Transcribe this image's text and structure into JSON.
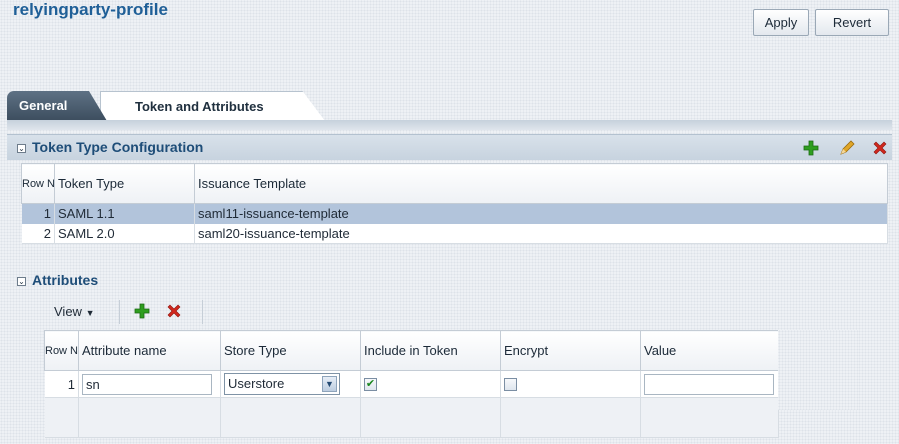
{
  "header": {
    "title": "relyingparty-profile",
    "apply_label": "Apply",
    "revert_label": "Revert"
  },
  "tabs": [
    {
      "label": "General",
      "active": false
    },
    {
      "label": "Token and Attributes",
      "active": true
    }
  ],
  "token_section": {
    "title": "Token Type Configuration",
    "columns": [
      "Row No.",
      "Token Type",
      "Issuance Template"
    ],
    "rows": [
      {
        "no": "1",
        "token_type": "SAML 1.1",
        "template": "saml11-issuance-template",
        "selected": true
      },
      {
        "no": "2",
        "token_type": "SAML 2.0",
        "template": "saml20-issuance-template",
        "selected": false
      }
    ]
  },
  "attributes_section": {
    "title": "Attributes",
    "view_label": "View",
    "columns": [
      "Row No.",
      "Attribute name",
      "Store Type",
      "Include in Token",
      "Encrypt",
      "Value"
    ],
    "rows": [
      {
        "no": "1",
        "name": "sn",
        "store_type": "Userstore",
        "include_in_token": true,
        "encrypt": false,
        "value": ""
      }
    ]
  },
  "colors": {
    "title_blue": "#1f5f97",
    "selected_row": "#b2c4db",
    "add_green": "#2e9e1f",
    "delete_red": "#d0281e"
  }
}
